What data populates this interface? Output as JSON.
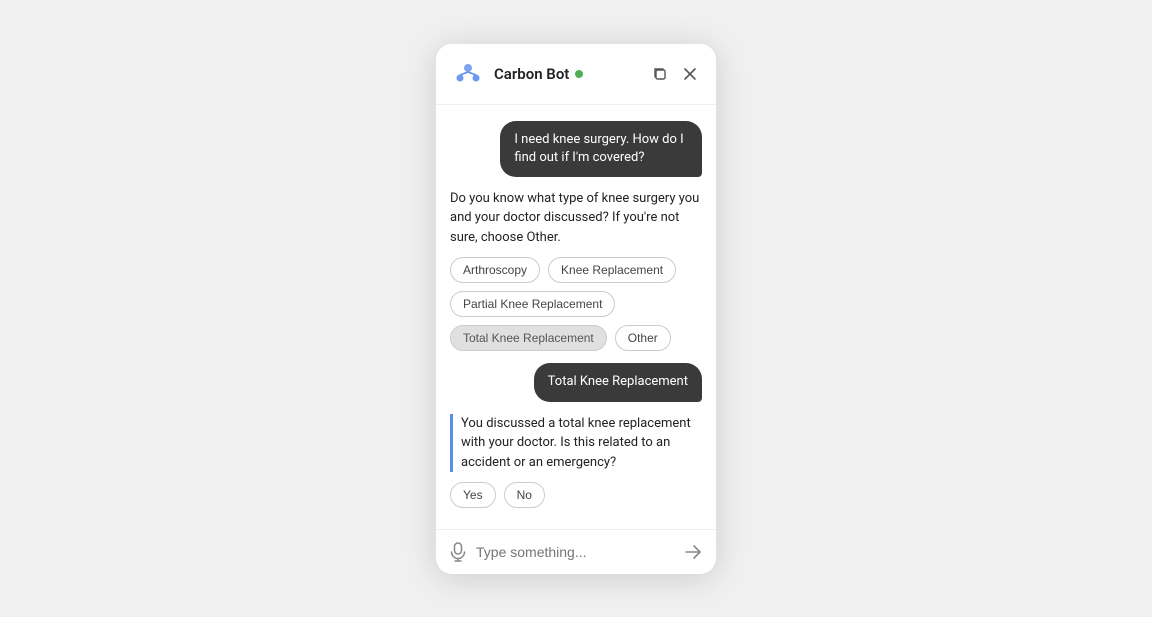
{
  "header": {
    "title": "Carbon Bot",
    "status": "online",
    "duplicate_icon": "duplicate-icon",
    "close_icon": "close-icon"
  },
  "messages": [
    {
      "type": "user",
      "text": "I need knee surgery. How do I find out if I'm covered?"
    },
    {
      "type": "bot",
      "text": "Do you know what type of knee surgery you and your doctor discussed? If you're not sure, choose Other."
    },
    {
      "type": "chips",
      "options": [
        "Arthroscopy",
        "Knee Replacement",
        "Partial Knee Replacement",
        "Total Knee Replacement",
        "Other"
      ]
    },
    {
      "type": "user",
      "text": "Total Knee Replacement"
    },
    {
      "type": "bot_followup",
      "text": "You discussed a total knee replacement with your doctor. Is this related to an accident or an emergency?"
    },
    {
      "type": "yes_no",
      "options": [
        "Yes",
        "No"
      ]
    }
  ],
  "input": {
    "placeholder": "Type something..."
  }
}
